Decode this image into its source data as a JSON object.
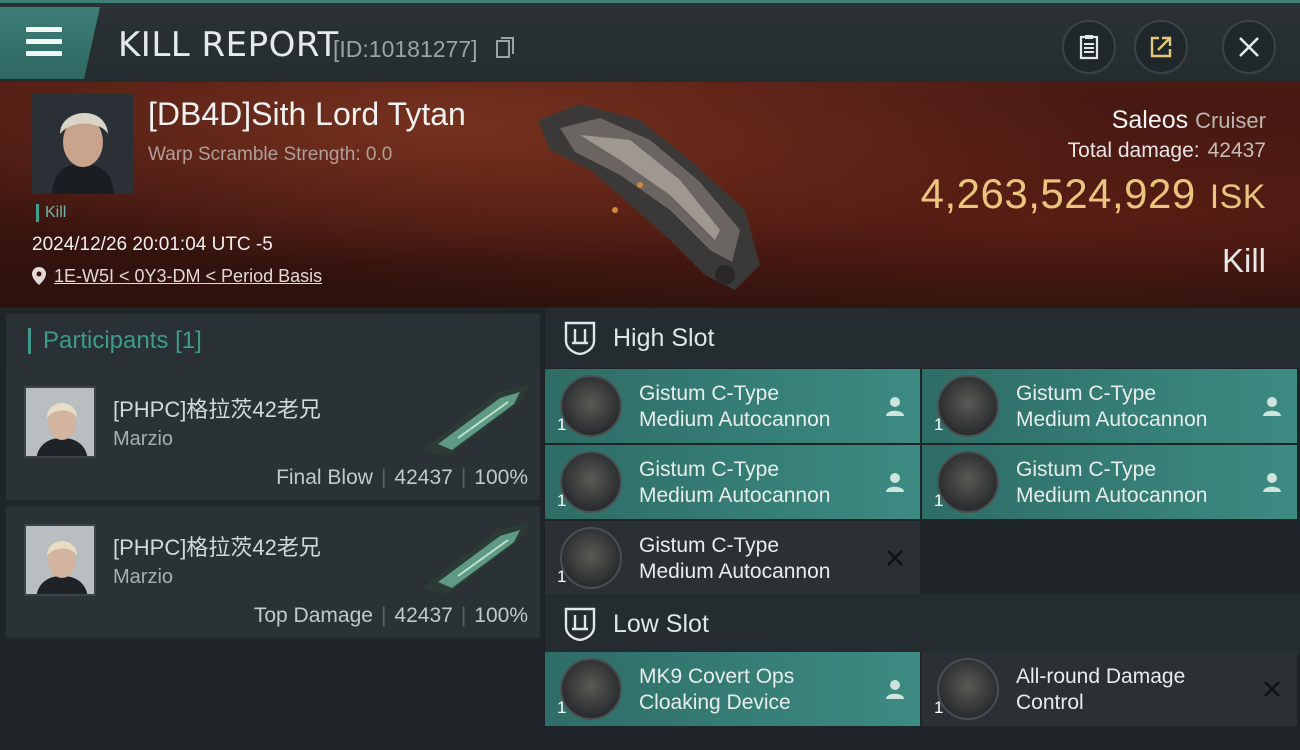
{
  "header": {
    "title": "KILL REPORT",
    "report_id": "[ID:10181277]"
  },
  "victim": {
    "name": "[DB4D]Sith Lord Tytan",
    "scramble": "Warp Scramble Strength: 0.0",
    "tag": "Kill",
    "datetime": "2024/12/26 20:01:04 UTC -5",
    "location": "1E-W5I < 0Y3-DM < Period Basis"
  },
  "ship": {
    "name": "Saleos",
    "class": "Cruiser",
    "total_damage_label": "Total damage:",
    "total_damage": "42437",
    "isk_value": "4,263,524,929",
    "isk_unit": "ISK",
    "result": "Kill"
  },
  "participants": {
    "label": "Participants",
    "count": "[1]",
    "rows": [
      {
        "name": "[PHPC]格拉茨42老兄",
        "corp": "Marzio",
        "role": "Final Blow",
        "damage": "42437",
        "percent": "100%"
      },
      {
        "name": "[PHPC]格拉茨42老兄",
        "corp": "Marzio",
        "role": "Top Damage",
        "damage": "42437",
        "percent": "100%"
      }
    ]
  },
  "fittings": {
    "high_slot_label": "High Slot",
    "low_slot_label": "Low Slot",
    "high": [
      {
        "qty": "1",
        "line1": "Gistum C-Type",
        "line2": "Medium Autocannon",
        "status": "person-icon"
      },
      {
        "qty": "1",
        "line1": "Gistum C-Type",
        "line2": "Medium Autocannon",
        "status": "person-icon"
      },
      {
        "qty": "1",
        "line1": "Gistum C-Type",
        "line2": "Medium Autocannon",
        "status": "person-icon"
      },
      {
        "qty": "1",
        "line1": "Gistum C-Type",
        "line2": "Medium Autocannon",
        "status": "person-icon"
      },
      {
        "qty": "1",
        "line1": "Gistum C-Type",
        "line2": "Medium Autocannon",
        "status": "close-icon"
      }
    ],
    "low": [
      {
        "qty": "1",
        "line1": "MK9 Covert Ops",
        "line2": "Cloaking Device",
        "status": "person-icon"
      },
      {
        "qty": "1",
        "line1": "All-round Damage",
        "line2": "Control",
        "status": "close-icon"
      }
    ]
  },
  "colors": {
    "accent": "#3f9a8d",
    "isk": "#e9c57d",
    "module_active": "#3c8b82",
    "module_destroyed": "#2a3034"
  }
}
